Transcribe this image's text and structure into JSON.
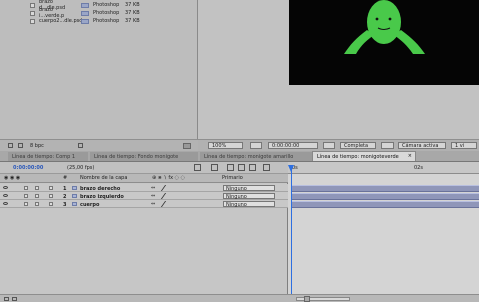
{
  "project": {
    "files": [
      {
        "name": "brazo d...dle.psd",
        "type": "Photoshop",
        "size": "37 KB"
      },
      {
        "name": "brazo i...verde.p",
        "type": "Photoshop",
        "size": "37 KB"
      },
      {
        "name": "cuerpo2...dle.psd",
        "type": "Photoshop",
        "size": "37 KB"
      }
    ],
    "footer_label": "8 bpc"
  },
  "viewer": {
    "zoom": "100%",
    "timecode": "0:00:00:00",
    "resolution": "Completa",
    "camera": "Cámara activa",
    "views": "1 vi"
  },
  "tabs": [
    {
      "label": "Línea de tiempo: Comp 1"
    },
    {
      "label": "Línea de tiempo: Fondo monigote"
    },
    {
      "label": "Línea de tiempo: monigote amarillo"
    },
    {
      "label": "Línea de tiempo: monigoteverde",
      "active": true
    }
  ],
  "timeline": {
    "timecode": "0:00:00:00",
    "fps": "(25,00 fps)",
    "columns": {
      "number": "#",
      "layer_name": "Nombre de la capa",
      "parent": "Primario"
    },
    "ruler_marks": [
      "0s",
      "02s"
    ],
    "layers": [
      {
        "number": "1",
        "name": "brazo derecho",
        "parent": "Ninguno"
      },
      {
        "number": "2",
        "name": "brazo izquierdo",
        "parent": "Ninguno"
      },
      {
        "number": "3",
        "name": "cuerpo",
        "parent": "Ninguno"
      }
    ]
  },
  "colors": {
    "accent": "#2d6fe1",
    "character": "#49c94a",
    "track": "#8f96b9"
  }
}
